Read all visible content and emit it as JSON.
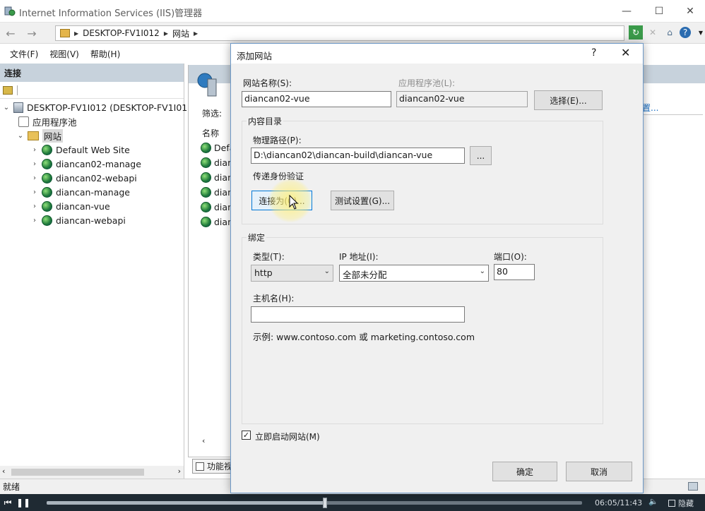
{
  "window": {
    "title": "Internet Information Services (IIS)管理器",
    "controls": [
      "—",
      "☐",
      "✕"
    ]
  },
  "address": {
    "path": [
      "DESKTOP-FV1I012",
      "网站"
    ],
    "toolbar_icons": [
      "refresh-icon",
      "stop-icon",
      "home-icon",
      "help-icon"
    ]
  },
  "menu": [
    "文件(F)",
    "视图(V)",
    "帮助(H)"
  ],
  "connections": {
    "header": "连接",
    "tree": [
      {
        "label": "DESKTOP-FV1I012 (DESKTOP-FV1I012",
        "icon": "server-icon",
        "level": 0,
        "expander": "v"
      },
      {
        "label": "应用程序池",
        "icon": "app-pool-icon",
        "level": 1,
        "expander": ""
      },
      {
        "label": "网站",
        "icon": "sites-folder-icon",
        "level": 1,
        "expander": "v",
        "selected": true
      },
      {
        "label": "Default Web Site",
        "icon": "globe-icon",
        "level": 2,
        "expander": ">"
      },
      {
        "label": "diancan02-manage",
        "icon": "globe-icon",
        "level": 2,
        "expander": ">"
      },
      {
        "label": "diancan02-webapi",
        "icon": "globe-icon",
        "level": 2,
        "expander": ">"
      },
      {
        "label": "diancan-manage",
        "icon": "globe-icon",
        "level": 2,
        "expander": ">"
      },
      {
        "label": "diancan-vue",
        "icon": "globe-icon",
        "level": 2,
        "expander": ">"
      },
      {
        "label": "diancan-webapi",
        "icon": "globe-icon",
        "level": 2,
        "expander": ">"
      }
    ]
  },
  "center": {
    "filter_label": "筛选:",
    "column_name": "名称",
    "rows": [
      "Defa",
      "dian",
      "dian",
      "dian",
      "dian",
      "dian"
    ],
    "features_view": "功能视",
    "right_link": "置..."
  },
  "status": "就绪",
  "player": {
    "time": "06:05/11:43",
    "hide": "隐藏",
    "progress": 0.52
  },
  "dialog": {
    "title": "添加网站",
    "help": "?",
    "close": "✕",
    "site_name_label": "网站名称(S):",
    "site_name_value": "diancan02-vue",
    "app_pool_label": "应用程序池(L):",
    "app_pool_value": "diancan02-vue",
    "select_button": "选择(E)...",
    "content_dir_label": "内容目录",
    "physical_path_label": "物理路径(P):",
    "physical_path_value": "D:\\diancan02\\diancan-build\\diancan-vue",
    "browse_button": "...",
    "passthrough_label": "传递身份验证",
    "connect_as_button": "连接为(C)...",
    "test_settings_button": "测试设置(G)...",
    "binding_label": "绑定",
    "type_label": "类型(T):",
    "type_value": "http",
    "ip_label": "IP 地址(I):",
    "ip_value": "全部未分配",
    "port_label": "端口(O):",
    "port_value": "80",
    "hostname_label": "主机名(H):",
    "hostname_value": "",
    "example_text": "示例: www.contoso.com 或 marketing.contoso.com",
    "start_checkbox_label": "立即启动网站(M)",
    "start_checked": true,
    "ok_button": "确定",
    "cancel_button": "取消"
  }
}
